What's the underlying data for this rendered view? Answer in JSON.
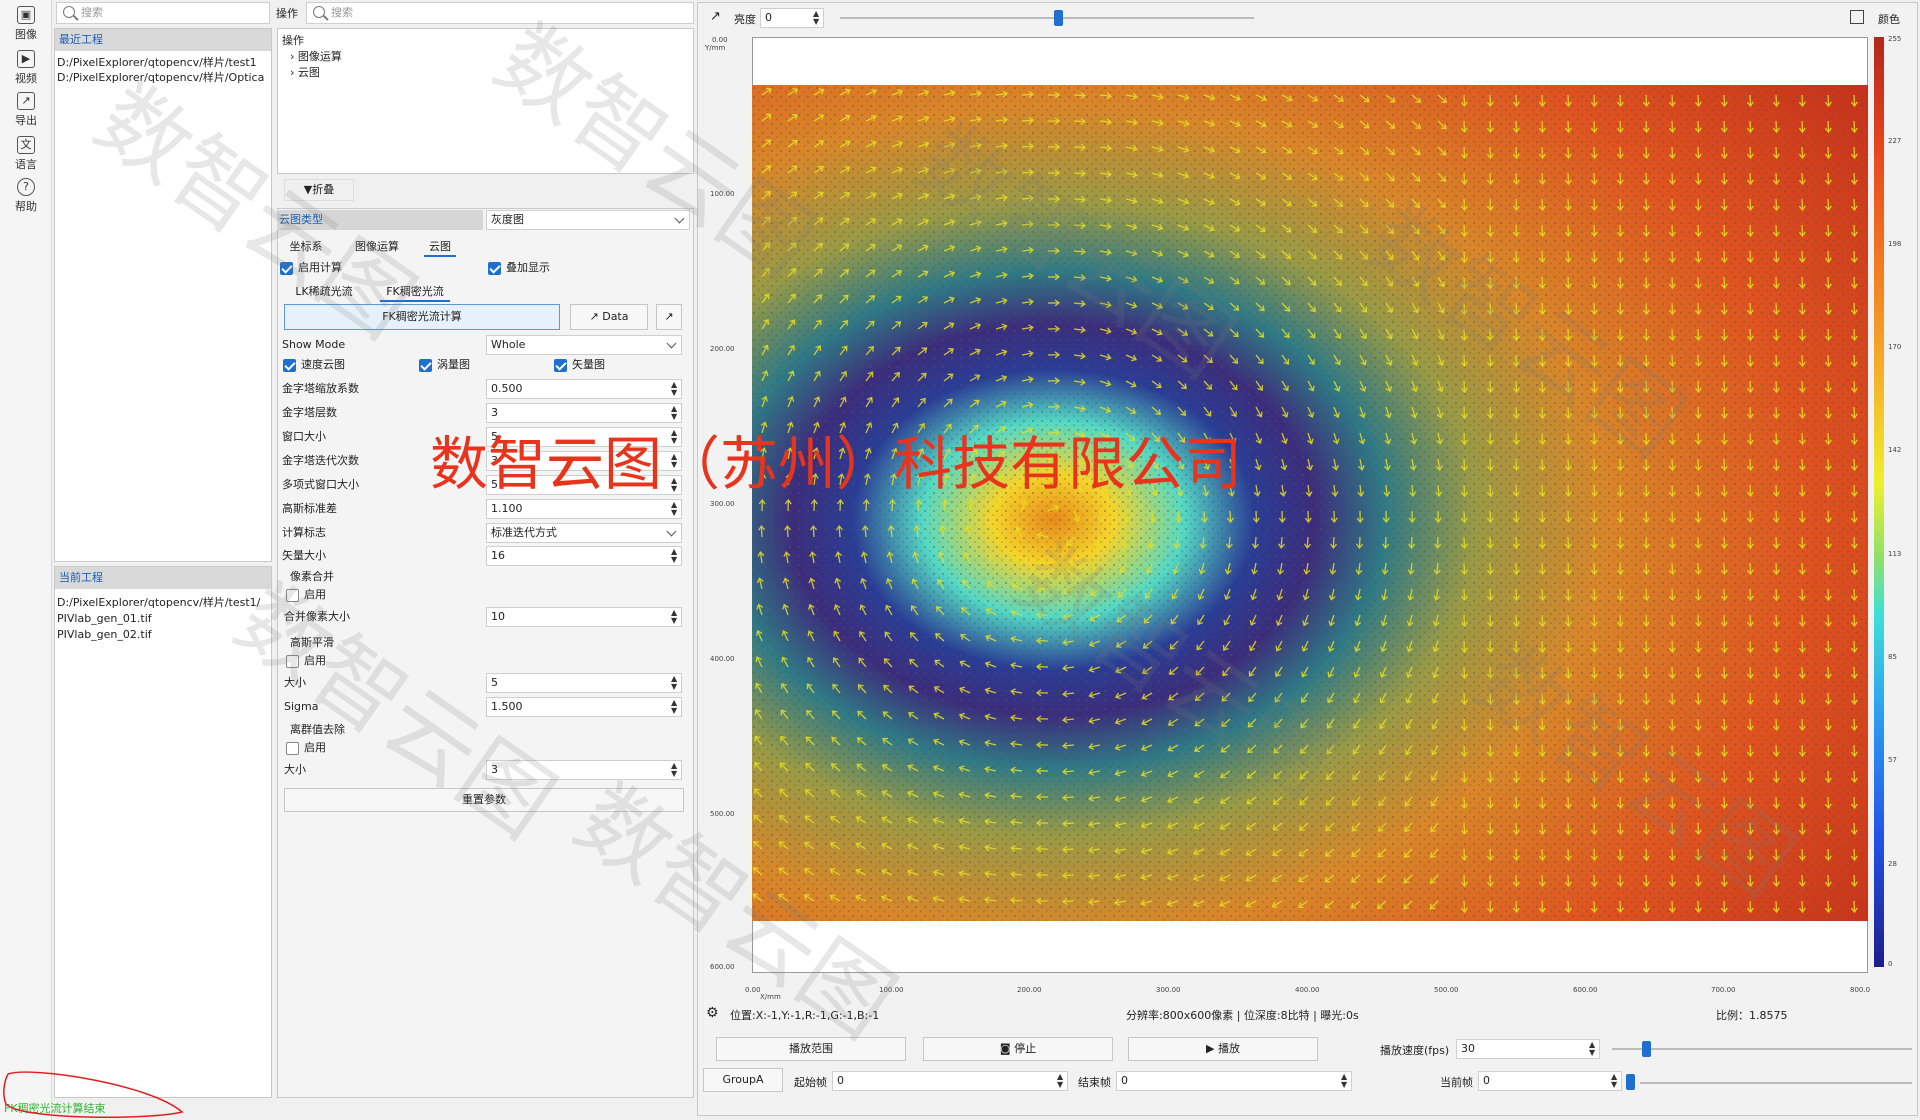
{
  "rail": {
    "items": [
      {
        "label": "图像",
        "icon": "image-icon"
      },
      {
        "label": "视频",
        "icon": "video-icon"
      },
      {
        "label": "导出",
        "icon": "export-icon"
      },
      {
        "label": "语言",
        "icon": "language-icon"
      },
      {
        "label": "帮助",
        "icon": "help-icon"
      }
    ]
  },
  "left": {
    "search_placeholder": "搜索",
    "recent_header": "最近工程",
    "recent_items": [
      "D:/PixelExplorer/qtopencv/样片/test1",
      "D:/PixelExplorer/qtopencv/样片/Optica"
    ],
    "current_header": "当前工程",
    "current_items": [
      "D:/PixelExplorer/qtopencv/样片/test1/",
      "PIVlab_gen_01.tif",
      "PIVlab_gen_02.tif"
    ],
    "status_text": "FK稠密光流计算结束"
  },
  "ops": {
    "title": "操作",
    "search_placeholder": "搜索",
    "tree_root": "操作",
    "tree_children": [
      "图像运算",
      "云图"
    ],
    "collapse_label": "▼折叠",
    "cloud_type_label": "云图类型",
    "cloud_type_value": "灰度图",
    "tabs": [
      "坐标系",
      "图像运算",
      "云图"
    ],
    "enable_calc_label": "启用计算",
    "overlay_label": "叠加显示",
    "flow_tabs": [
      "LK稀疏光流",
      "FK稠密光流"
    ],
    "calc_button": "FK稠密光流计算",
    "data_button": "Data",
    "show_mode_label": "Show Mode",
    "show_mode_value": "Whole",
    "show_checks": [
      "速度云图",
      "涡量图",
      "矢量图"
    ],
    "params": [
      {
        "label": "金字塔缩放系数",
        "value": "0.500"
      },
      {
        "label": "金字塔层数",
        "value": "3"
      },
      {
        "label": "窗口大小",
        "value": "5"
      },
      {
        "label": "金字塔迭代次数",
        "value": "3"
      },
      {
        "label": "多项式窗口大小",
        "value": "5"
      },
      {
        "label": "高斯标准差",
        "value": "1.100"
      }
    ],
    "calc_flag_label": "计算标志",
    "calc_flag_value": "标准迭代方式",
    "vector_size_label": "矢量大小",
    "vector_size_value": "16",
    "merge_group": "像素合并",
    "merge_enable": "启用",
    "merge_size_label": "合并像素大小",
    "merge_size_value": "10",
    "gauss_group": "高斯平滑",
    "gauss_enable": "启用",
    "gauss_size_label": "大小",
    "gauss_size_value": "5",
    "sigma_label": "Sigma",
    "sigma_value": "1.500",
    "outlier_group": "离群值去除",
    "outlier_enable": "启用",
    "outlier_size_label": "大小",
    "outlier_size_value": "3",
    "reset_button": "重置参数"
  },
  "viewer": {
    "brightness_label": "亮度",
    "brightness_value": "0",
    "color_label": "颜色",
    "y_axis_title": "Y/mm",
    "x_axis_title": "X/mm",
    "y_ticks": [
      "0.00",
      "100.00",
      "200.00",
      "300.00",
      "400.00",
      "500.00",
      "600.00"
    ],
    "x_ticks": [
      "0.00",
      "100.00",
      "200.00",
      "300.00",
      "400.00",
      "500.00",
      "600.00",
      "700.00",
      "800.0"
    ],
    "cb_ticks": [
      "255",
      "227",
      "198",
      "170",
      "142",
      "113",
      "85",
      "57",
      "28",
      "0"
    ],
    "position_text": "位置:X:-1,Y:-1,R:-1,G:-1,B:-1",
    "resolution_text": "分辨率:800x600像素 | 位深度:8比特 | 曝光:0s",
    "scale_text": "比例：1.8575",
    "range_button": "播放范围",
    "stop_button": "停止",
    "play_button": "播放",
    "speed_label": "播放速度(fps)",
    "speed_value": "30",
    "group_button": "GroupA",
    "start_label": "起始帧",
    "start_value": "0",
    "end_label": "结束帧",
    "end_value": "0",
    "current_label": "当前帧",
    "current_value": "0"
  },
  "overlay": {
    "company": "数智云图（苏州）科技有限公司",
    "watermark": "数智云图"
  }
}
